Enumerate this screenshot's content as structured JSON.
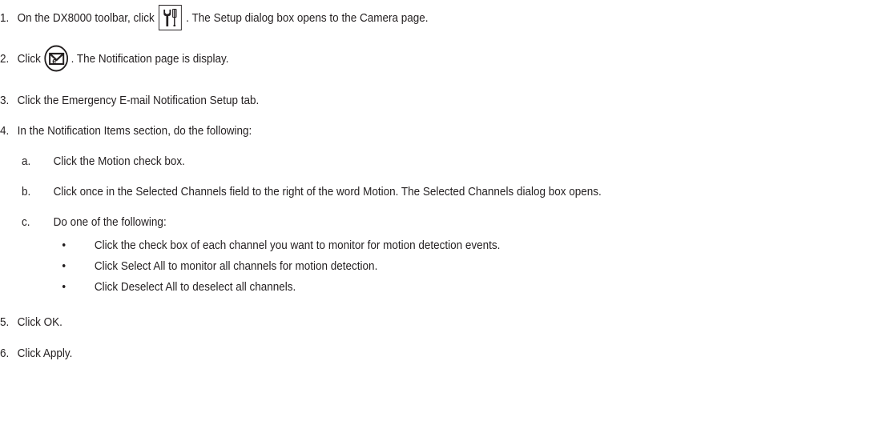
{
  "steps": [
    {
      "num": "1.",
      "before": "On the DX8000 toolbar, click",
      "icon": "setup-wrench-screwdriver-icon",
      "after": ". The Setup dialog box opens to the Camera page."
    },
    {
      "num": "2.",
      "before": "Click",
      "icon": "notification-email-icon",
      "after": ". The Notification page is display."
    },
    {
      "num": "3.",
      "text": "Click the Emergency E-mail Notification Setup tab."
    },
    {
      "num": "4.",
      "text": "In the Notification Items section, do the following:",
      "substeps": [
        {
          "letter": "a.",
          "text": "Click the Motion check box."
        },
        {
          "letter": "b.",
          "text": "Click once in the Selected Channels field to the right of the word Motion. The Selected Channels dialog box opens."
        },
        {
          "letter": "c.",
          "text": "Do one of the following:",
          "bullets": [
            "Click the check box of each channel you want to monitor for motion detection events.",
            "Click Select All to monitor all channels for motion detection.",
            "Click Deselect All to deselect all channels."
          ]
        }
      ]
    },
    {
      "num": "5.",
      "text": "Click OK."
    },
    {
      "num": "6.",
      "text": "Click Apply."
    }
  ],
  "bullet_glyph": "•",
  "colors": {
    "text": "#231f20",
    "background": "#ffffff"
  }
}
